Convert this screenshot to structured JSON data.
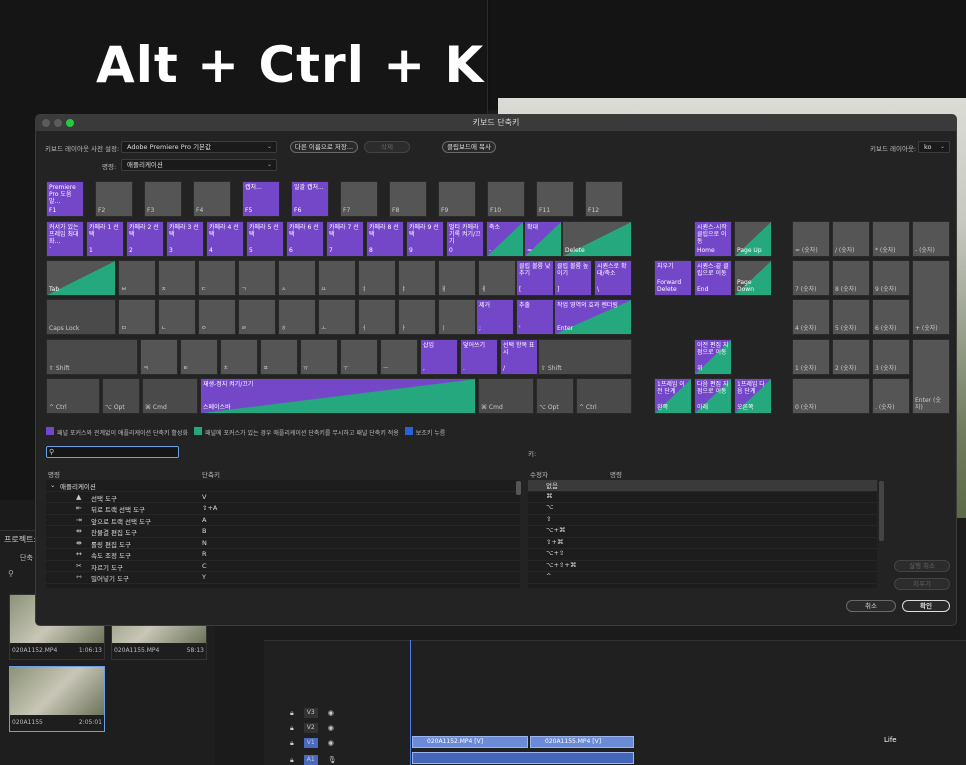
{
  "overlay_title": "Alt + Ctrl + K",
  "dialog": {
    "title": "키보드 단축키",
    "preset_label": "키보드 레이아웃 사전 설정:",
    "preset_value": "Adobe Premiere Pro 기본값",
    "save_as": "다른 이름으로 저장...",
    "delete": "삭제",
    "copy_clipboard": "클립보드에 복사",
    "layout_label": "키보드 레이아웃:",
    "layout_value": "ko",
    "command_label": "명령:",
    "command_value": "애플리케이션"
  },
  "keys": {
    "f1": {
      "t": "Premiere Pro 도움말...",
      "b": "F1"
    },
    "f2": {
      "b": "F2"
    },
    "f3": {
      "b": "F3"
    },
    "f4": {
      "b": "F4"
    },
    "f5": {
      "t": "캡처...",
      "b": "F5"
    },
    "f6": {
      "t": "일괄 캡처...",
      "b": "F6"
    },
    "f7": {
      "b": "F7"
    },
    "f8": {
      "b": "F8"
    },
    "f9": {
      "b": "F9"
    },
    "f10": {
      "b": "F10"
    },
    "f11": {
      "b": "F11"
    },
    "f12": {
      "b": "F12"
    },
    "grave": {
      "t": "커서가 있는 프레임 최대화...",
      "b": "`"
    },
    "k1": {
      "t": "카메라 1 선택",
      "b": "1"
    },
    "k2": {
      "t": "카메라 2 선택",
      "b": "2"
    },
    "k3": {
      "t": "카메라 3 선택",
      "b": "3"
    },
    "k4": {
      "t": "카메라 4 선택",
      "b": "4"
    },
    "k5": {
      "t": "카메라 5 선택",
      "b": "5"
    },
    "k6": {
      "t": "카메라 6 선택",
      "b": "6"
    },
    "k7": {
      "t": "카메라 7 선택",
      "b": "7"
    },
    "k8": {
      "t": "카메라 8 선택",
      "b": "8"
    },
    "k9": {
      "t": "카메라 9 선택",
      "b": "9"
    },
    "k0": {
      "t": "멀티 카메라 기록 켜기/끄기",
      "b": "0"
    },
    "minus": {
      "t": "축소",
      "b": "-"
    },
    "equal": {
      "t": "확대",
      "b": "="
    },
    "delete": {
      "b": "Delete"
    },
    "tab": {
      "b": "Tab"
    },
    "q": {
      "b": "ㅂ"
    },
    "w": {
      "b": "ㅈ"
    },
    "e": {
      "b": "ㄷ"
    },
    "r": {
      "b": "ㄱ"
    },
    "t": {
      "b": "ㅅ"
    },
    "y": {
      "b": "ㅛ"
    },
    "u": {
      "b": "ㅕ"
    },
    "i": {
      "b": "ㅑ"
    },
    "o": {
      "b": "ㅐ"
    },
    "pk": {
      "b": "ㅔ"
    },
    "lbracket": {
      "t": "클립 볼륨 낮추기",
      "b": "["
    },
    "rbracket": {
      "t": "클립 볼륨 높이기",
      "b": "]"
    },
    "backslash": {
      "t": "시퀀스로 확대/축소",
      "b": "\\"
    },
    "caps": {
      "b": "Caps Lock"
    },
    "a": {
      "b": "ㅁ"
    },
    "s": {
      "b": "ㄴ"
    },
    "d": {
      "b": "ㅇ"
    },
    "f": {
      "b": "ㄹ"
    },
    "g": {
      "b": "ㅎ"
    },
    "h": {
      "b": "ㅗ"
    },
    "j": {
      "b": "ㅓ"
    },
    "k": {
      "b": "ㅏ"
    },
    "l": {
      "b": "ㅣ"
    },
    "semicolon": {
      "t": "제거",
      "b": ";"
    },
    "quote": {
      "t": "추출",
      "b": "'"
    },
    "enter": {
      "t": "작업 영역의 효과 렌더링",
      "b": "Enter"
    },
    "lshift": {
      "b": "⇧ Shift"
    },
    "z": {
      "b": "ㅋ"
    },
    "x": {
      "b": "ㅌ"
    },
    "c": {
      "b": "ㅊ"
    },
    "v": {
      "b": "ㅍ"
    },
    "bk": {
      "b": "ㅠ"
    },
    "n": {
      "b": "ㅜ"
    },
    "m": {
      "b": "ㅡ"
    },
    "comma": {
      "t": "삽입",
      "b": ","
    },
    "period": {
      "t": "덮어쓰기",
      "b": "."
    },
    "slash": {
      "t": "선택 항목 표시",
      "b": "/"
    },
    "rshift": {
      "b": "⇧ Shift"
    },
    "lctrl": {
      "b": "^ Ctrl"
    },
    "lopt": {
      "b": "⌥ Opt"
    },
    "lcmd": {
      "b": "⌘ Cmd"
    },
    "space": {
      "t": "재생-정지 켜기/끄기",
      "b": "스페이스바"
    },
    "rcmd": {
      "b": "⌘ Cmd"
    },
    "ropt": {
      "b": "⌥ Opt"
    },
    "rctrl": {
      "b": "^ Ctrl"
    },
    "home": {
      "t": "시퀀스-시작 클립으로 이동",
      "b": "Home"
    },
    "pgup": {
      "b": "Page Up"
    },
    "fwddel": {
      "t": "지우기",
      "b": "Forward Delete"
    },
    "end": {
      "t": "시퀀스-끝 클립으로 이동",
      "b": "End"
    },
    "pgdn": {
      "b": "Page Down"
    },
    "up": {
      "t": "이전 편집 지점으로 이동",
      "b": "위"
    },
    "left": {
      "t": "1프레임 이전 단계",
      "b": "왼쪽"
    },
    "down": {
      "t": "다음 편집 지점으로 이동",
      "b": "아래"
    },
    "right": {
      "t": "1프레임 다음 단계",
      "b": "오른쪽"
    },
    "np_eq": {
      "b": "= (숫자)"
    },
    "np_div": {
      "b": "/ (숫자)"
    },
    "np_mul": {
      "b": "* (숫자)"
    },
    "np_sub": {
      "b": "- (숫자)"
    },
    "np7": {
      "b": "7 (숫자)"
    },
    "np8": {
      "b": "8 (숫자)"
    },
    "np9": {
      "b": "9 (숫자)"
    },
    "np4": {
      "b": "4 (숫자)"
    },
    "np5": {
      "b": "5 (숫자)"
    },
    "np6": {
      "b": "6 (숫자)"
    },
    "np_add": {
      "b": "+ (숫자)"
    },
    "np1": {
      "b": "1 (숫자)"
    },
    "np2": {
      "b": "2 (숫자)"
    },
    "np3": {
      "b": "3 (숫자)"
    },
    "np0": {
      "b": "0 (숫자)"
    },
    "np_dot": {
      "b": ". (숫자)"
    },
    "np_enter": {
      "b": "Enter (숫자)"
    }
  },
  "legend": {
    "purple": "패널 포커스와 관계없이 애플리케이션 단축키 활성화",
    "green": "패널에 포커스가 있는 경우 애플리케이션 단축키를 무시하고 패널 단축키 적용",
    "blue": "보조키 누름"
  },
  "colors": {
    "purple": "#7446c8",
    "green": "#25a87d",
    "blue": "#2a62d6"
  },
  "search": {
    "value": ""
  },
  "key_label": "키:",
  "columns": {
    "command": "명령",
    "shortcut": "단축키",
    "modifier": "수정자",
    "mod_command": "명령"
  },
  "command_group": "애플리케이션",
  "commands": [
    {
      "name": "선택 도구",
      "shortcut": "V",
      "icon": "selection-tool-icon",
      "glyph": "▲"
    },
    {
      "name": "뒤로 트랙 선택 도구",
      "shortcut": "⇧+A",
      "icon": "track-select-backward-icon",
      "glyph": "⇤"
    },
    {
      "name": "앞으로 트랙 선택 도구",
      "shortcut": "A",
      "icon": "track-select-forward-icon",
      "glyph": "⇥"
    },
    {
      "name": "잔물결 편집 도구",
      "shortcut": "B",
      "icon": "ripple-edit-icon",
      "glyph": "⇹"
    },
    {
      "name": "롤링 편집 도구",
      "shortcut": "N",
      "icon": "rolling-edit-icon",
      "glyph": "⇼"
    },
    {
      "name": "속도 조정 도구",
      "shortcut": "R",
      "icon": "rate-stretch-icon",
      "glyph": "↔"
    },
    {
      "name": "자르기 도구",
      "shortcut": "C",
      "icon": "razor-tool-icon",
      "glyph": "✂"
    },
    {
      "name": "밀어넣기 도구",
      "shortcut": "Y",
      "icon": "slip-tool-icon",
      "glyph": "⇿"
    }
  ],
  "modifiers": [
    "없음",
    "⌘",
    "⌥",
    "⇧",
    "⌥+⌘",
    "⇧+⌘",
    "⌥+⇧",
    "⌥+⇧+⌘",
    "^"
  ],
  "side_buttons": {
    "undo": "실행 취소",
    "clear": "지우기"
  },
  "footer": {
    "cancel": "취소",
    "ok": "확인"
  },
  "project": {
    "tab": "프로젝트: 단",
    "sub": "단축",
    "clips": [
      {
        "name": "020A1152.MP4",
        "dur": "1:06:13"
      },
      {
        "name": "020A1155.MP4",
        "dur": "58:13"
      },
      {
        "name": "020A1155",
        "dur": "2:05:01"
      }
    ]
  },
  "timeline": {
    "tracks": [
      "V3",
      "V2",
      "V1",
      "A1"
    ],
    "clip1": "020A1152.MP4 [V]",
    "clip2": "020A1155.MP4 [V]"
  },
  "watermark": "Life"
}
